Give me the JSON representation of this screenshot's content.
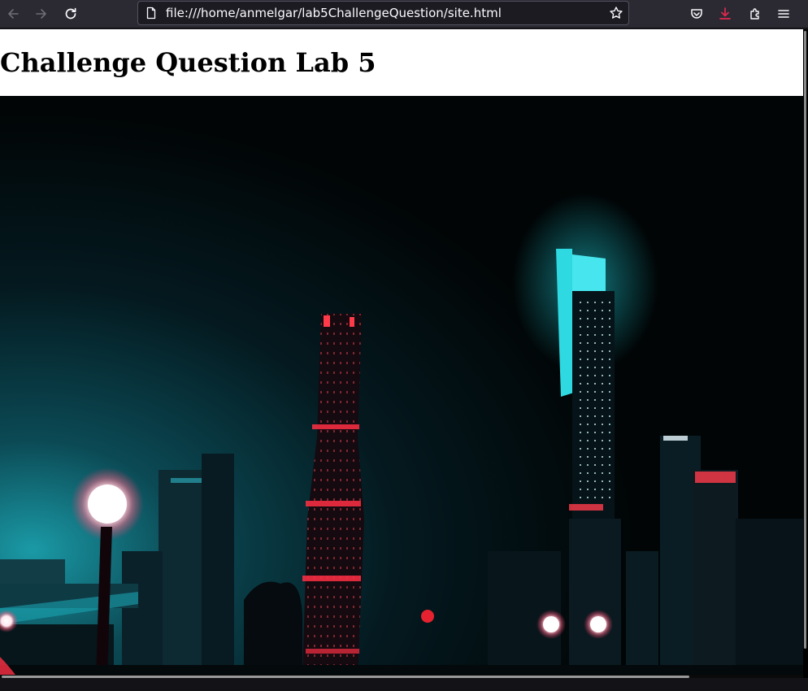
{
  "browser": {
    "url": "file:///home/anmelgar/lab5ChallengeQuestion/site.html",
    "nav": {
      "back_icon": "back-arrow-icon",
      "forward_icon": "forward-arrow-icon",
      "reload_icon": "reload-icon"
    },
    "toolbar_icons": [
      "bookmark-star-icon",
      "pocket-icon",
      "downloads-icon",
      "extensions-icon",
      "menu-icon"
    ],
    "colors": {
      "chrome": "#2b2a33",
      "download_accent": "#e22850"
    }
  },
  "page": {
    "title": "Challenge Question Lab 5",
    "image": "night-city-skyline"
  }
}
